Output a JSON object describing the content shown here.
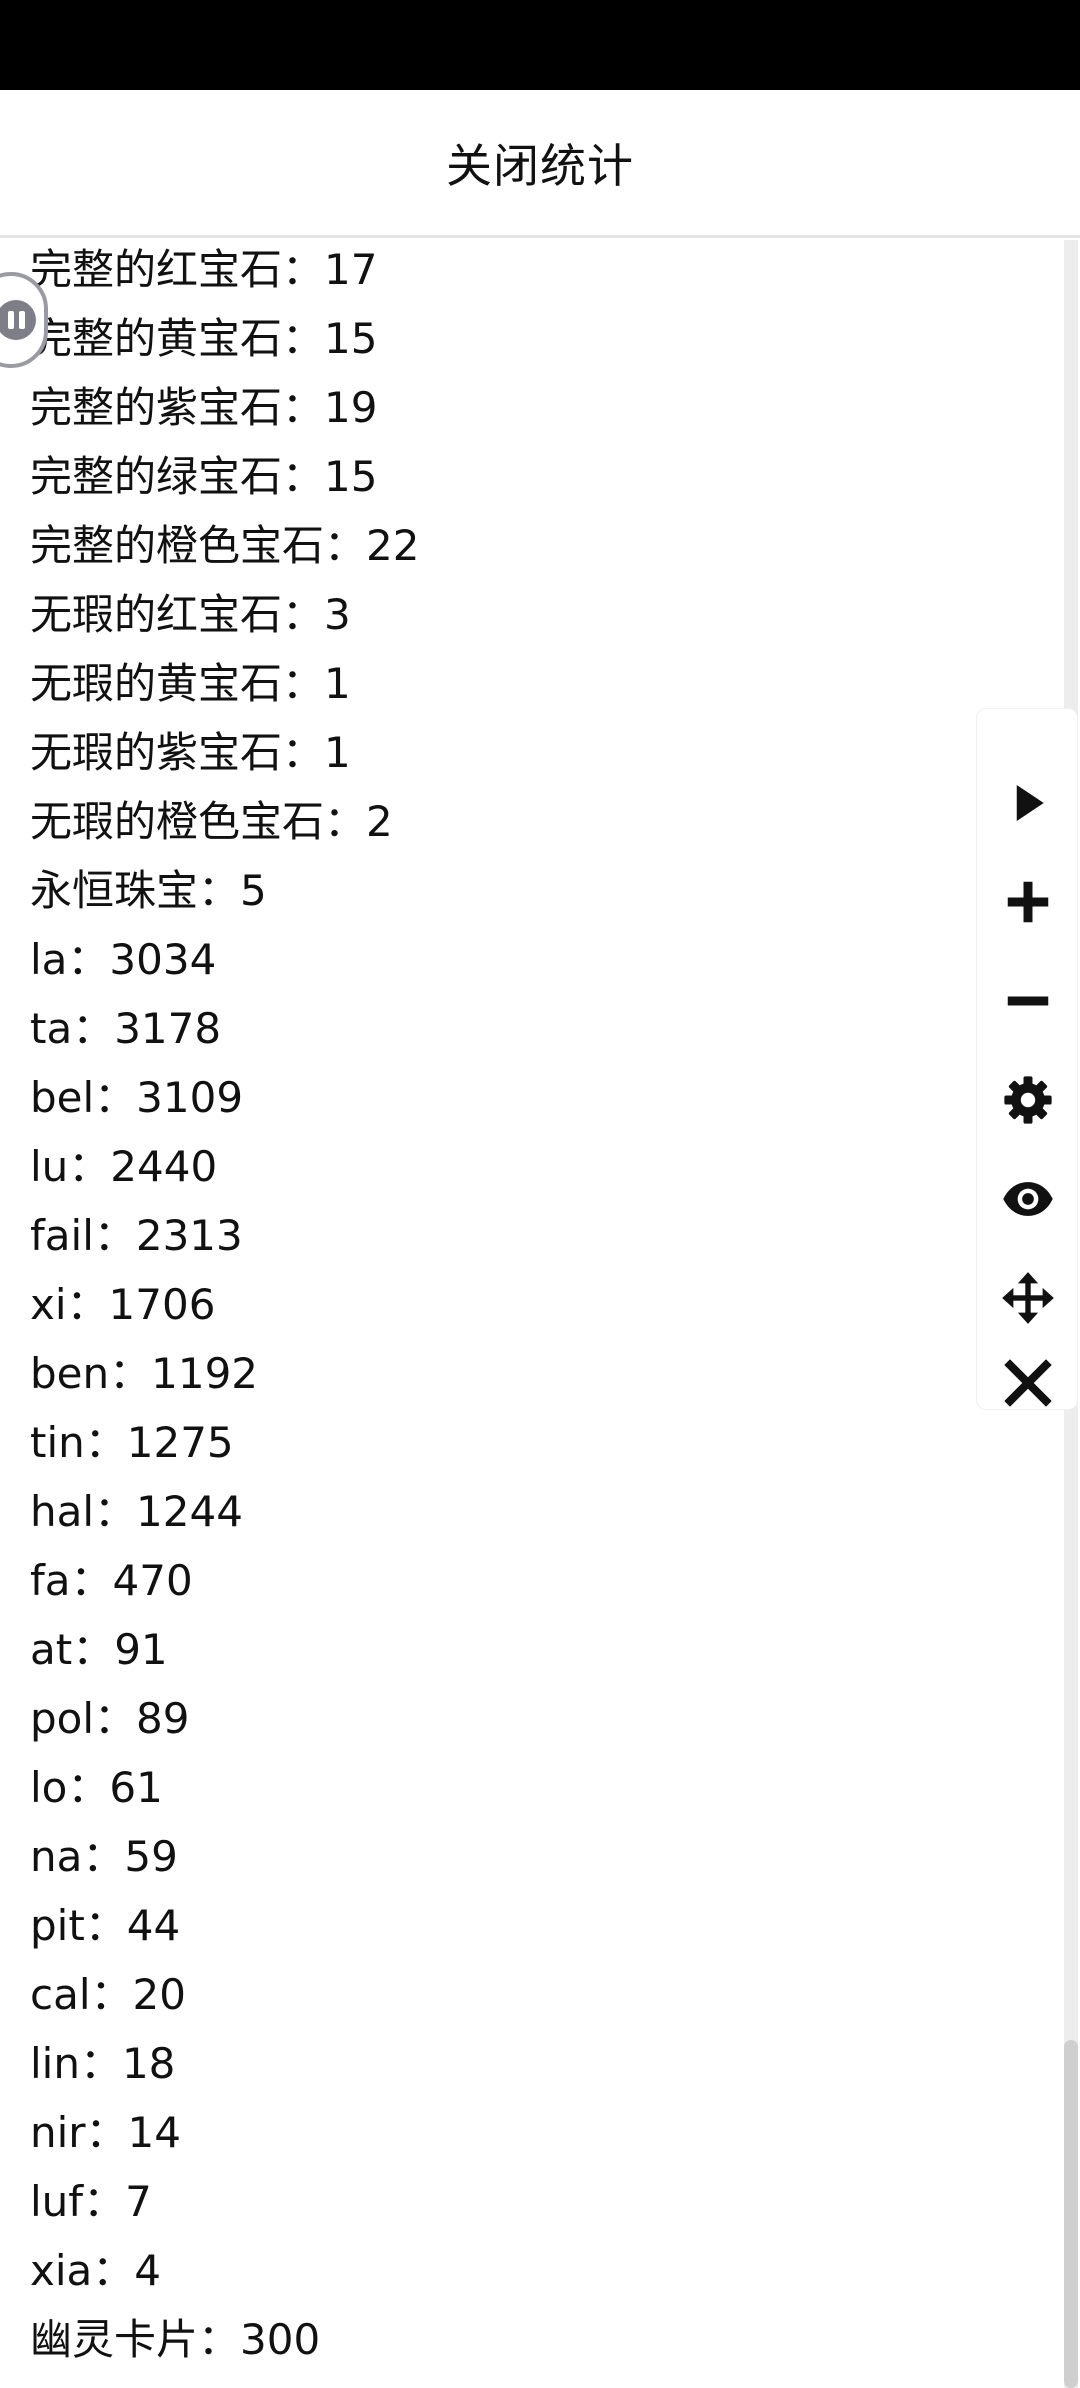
{
  "header": {
    "title": "关闭统计"
  },
  "stats": [
    "完整的红宝石：17",
    "完整的黄宝石：15",
    "完整的紫宝石：19",
    "完整的绿宝石：15",
    "完整的橙色宝石：22",
    "无瑕的红宝石：3",
    "无瑕的黄宝石：1",
    "无瑕的紫宝石：1",
    "无瑕的橙色宝石：2",
    "永恒珠宝：5",
    "la：3034",
    "ta：3178",
    "bel：3109",
    "lu：2440",
    "fail：2313",
    "xi：1706",
    "ben：1192",
    "tin：1275",
    "hal：1244",
    "fa：470",
    "at：91",
    "pol：89",
    "lo：61",
    "na：59",
    "pit：44",
    "cal：20",
    "lin：18",
    "nir：14",
    "luf：7",
    "xia：4",
    "幽灵卡片：300"
  ],
  "toolbar": {
    "icons": [
      "play-icon",
      "plus-icon",
      "minus-icon",
      "gear-icon",
      "eye-icon",
      "move-icon",
      "close-icon"
    ]
  },
  "colors": {
    "status_bar": "#000000",
    "text": "#111111",
    "icon": "#111111",
    "divider": "#e4e4e4"
  }
}
